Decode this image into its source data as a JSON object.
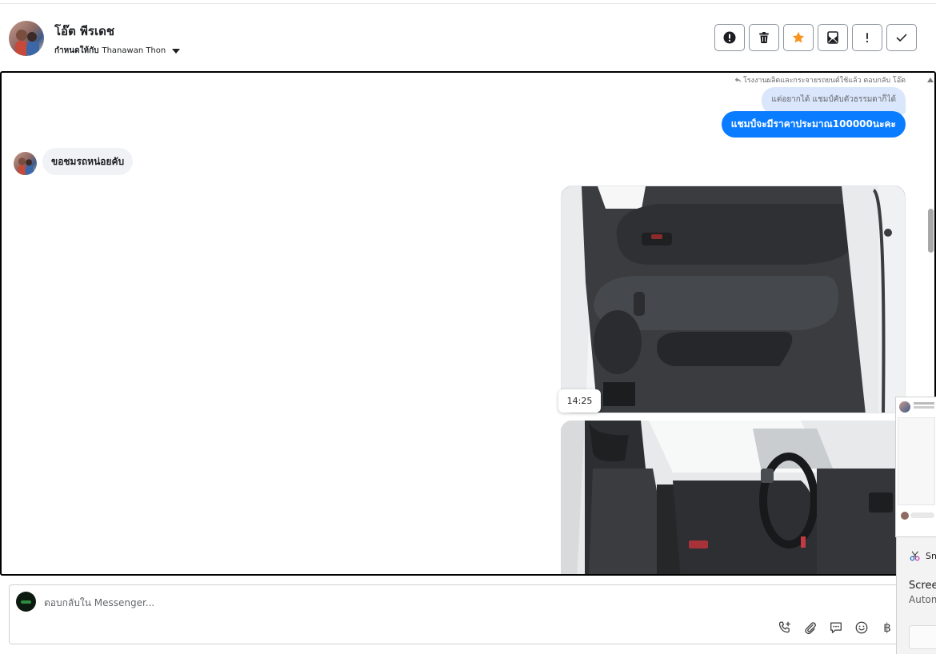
{
  "header": {
    "contact_name": "โอ๊ต พีรเดช",
    "assigned_label": "กำหนดให้กับ",
    "assigned_to": "Thanawan Thon",
    "actions": [
      {
        "name": "spam-action-button",
        "icon": "alert-circle-icon"
      },
      {
        "name": "delete-action-button",
        "icon": "trash-icon"
      },
      {
        "name": "star-action-button",
        "icon": "star-icon"
      },
      {
        "name": "mark-unread-action-button",
        "icon": "mail-icon"
      },
      {
        "name": "follow-up-action-button",
        "icon": "exclamation-icon"
      },
      {
        "name": "done-action-button",
        "icon": "check-icon"
      }
    ],
    "star_color": "#f7931e"
  },
  "chat": {
    "reply_note": "โรงงานผลิตและกระจายรถยนต์ใช้แล้ว ตอบกลับ โอ๊ต",
    "quoted_text": "แต่อยากได้ แชมป์คับตัวธรรมดาก็ได้",
    "sent_text": "แชมป์จะมีราคาประมาณ100000นะคะ",
    "received_text": "ขอชมรถหน่อยคับ",
    "timestamp": "14:25",
    "sent_bubble_color": "#0a7cff"
  },
  "composer": {
    "placeholder": "ตอบกลับใน Messenger..."
  },
  "toast": {
    "app_name": "Sn",
    "title": "Screen",
    "subtitle": "Autom"
  }
}
